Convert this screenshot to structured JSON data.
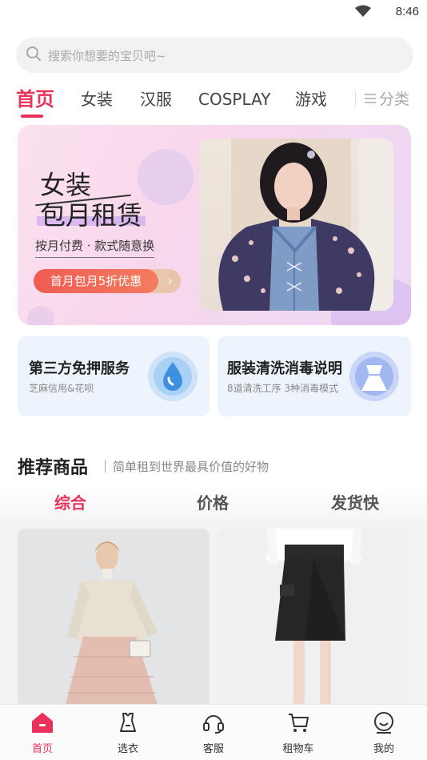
{
  "status_bar": {
    "time": "8:46",
    "wifi_icon": "wifi-icon"
  },
  "search": {
    "placeholder": "搜索你想要的宝贝吧~",
    "icon": "search-icon"
  },
  "tabs": [
    {
      "label": "首页",
      "active": true
    },
    {
      "label": "女装",
      "active": false
    },
    {
      "label": "汉服",
      "active": false
    },
    {
      "label": "COSPLAY",
      "active": false
    },
    {
      "label": "游戏",
      "active": false
    }
  ],
  "category_tab": {
    "label": "分类",
    "icon": "menu-icon"
  },
  "banner": {
    "title_line1": "女装",
    "title_line2": "包月租赁",
    "subtitle": "按月付费 · 款式随意换",
    "cta": "首月包月5折优惠",
    "cta_arrow": "›"
  },
  "services": [
    {
      "title": "第三方免押服务",
      "desc": "芝麻信用&花呗",
      "icon": "water-drop-icon"
    },
    {
      "title": "服装清洗消毒说明",
      "desc": "8道清洗工序 3种消毒模式",
      "icon": "dress-icon"
    }
  ],
  "recommend": {
    "title": "推荐商品",
    "subtitle": "简单租到世界最具价值的好物"
  },
  "sort_tabs": [
    {
      "label": "综合",
      "active": true
    },
    {
      "label": "价格",
      "active": false
    },
    {
      "label": "发货快",
      "active": false
    }
  ],
  "products": [
    {
      "name": "sweater-tulle-skirt"
    },
    {
      "name": "black-skirt"
    }
  ],
  "bottom_nav": [
    {
      "label": "首页",
      "icon": "home-icon",
      "active": true
    },
    {
      "label": "选衣",
      "icon": "clothes-icon",
      "active": false
    },
    {
      "label": "客服",
      "icon": "headset-icon",
      "active": false
    },
    {
      "label": "租物车",
      "icon": "cart-icon",
      "active": false
    },
    {
      "label": "我的",
      "icon": "profile-icon",
      "active": false
    }
  ],
  "colors": {
    "accent": "#e8325c",
    "cta": "#f05b52",
    "service_bg": "#eef4fd"
  }
}
